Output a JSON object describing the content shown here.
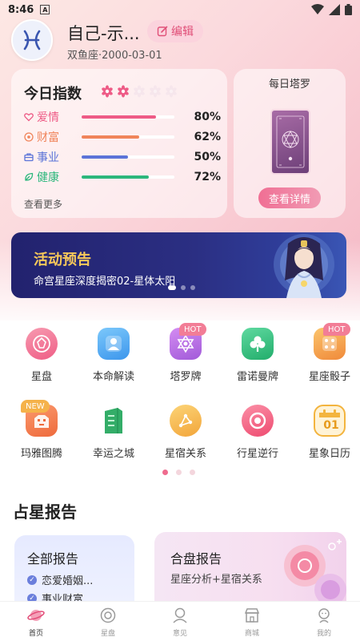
{
  "status_bar": {
    "time": "8:46",
    "notification_glyph": "A"
  },
  "profile": {
    "name": "自己-示...",
    "edit_label": "编辑",
    "sub": "双鱼座·2000-03-01",
    "avatar_icon": "pisces-icon"
  },
  "index": {
    "title": "今日指数",
    "level": 2,
    "level_max": 5,
    "more_label": "查看更多",
    "items": [
      {
        "label": "爱情",
        "value": "80%",
        "fraction": 0.8,
        "color": "#ee5b86",
        "icon": "heart-icon"
      },
      {
        "label": "财富",
        "value": "62%",
        "fraction": 0.62,
        "color": "#f0845a",
        "icon": "coin-icon"
      },
      {
        "label": "事业",
        "value": "50%",
        "fraction": 0.5,
        "color": "#5b74d8",
        "icon": "briefcase-icon"
      },
      {
        "label": "健康",
        "value": "72%",
        "fraction": 0.72,
        "color": "#2cb77c",
        "icon": "leaf-icon"
      }
    ]
  },
  "tarot": {
    "title": "每日塔罗",
    "button": "查看详情"
  },
  "banner": {
    "title": "活动预告",
    "subtitle": "命宫星座深度揭密02-星体太阳",
    "slide_count": 3,
    "active_slide": 0
  },
  "grid": {
    "items": [
      {
        "label": "星盘",
        "icon": "astrolabe-icon",
        "bg": "#f47a9a",
        "badge": ""
      },
      {
        "label": "本命解读",
        "icon": "person-card-icon",
        "bg": "#4aa6f0",
        "badge": ""
      },
      {
        "label": "塔罗牌",
        "icon": "hexagram-icon",
        "bg": "#b66ce0",
        "badge": "HOT"
      },
      {
        "label": "雷诺曼牌",
        "icon": "clover-icon",
        "bg": "#2fc27f",
        "badge": ""
      },
      {
        "label": "星座骰子",
        "icon": "dice-icon",
        "bg": "#f4a548",
        "badge": "HOT"
      },
      {
        "label": "玛雅图腾",
        "icon": "totem-icon",
        "bg": "#f08758",
        "badge": "NEW"
      },
      {
        "label": "幸运之城",
        "icon": "building-icon",
        "bg": "#3ab26c",
        "badge": ""
      },
      {
        "label": "星宿关系",
        "icon": "constellation-icon",
        "bg": "#f5b542",
        "badge": ""
      },
      {
        "label": "行星逆行",
        "icon": "planet-ring-icon",
        "bg": "#f25d7c",
        "badge": ""
      },
      {
        "label": "星象日历",
        "icon": "calendar-icon",
        "bg": "#f6c35a",
        "badge": "",
        "calendar_day": "01"
      }
    ],
    "page_count": 3,
    "active_page": 0
  },
  "reports": {
    "section_title": "占星报告",
    "all": {
      "title": "全部报告",
      "items": [
        "恋爱婚姻...",
        "事业财富..."
      ]
    },
    "synastry": {
      "title": "合盘报告",
      "sub": "星座分析+星宿关系"
    }
  },
  "bottom_nav": [
    {
      "label": "首页",
      "icon": "planet-icon",
      "active": true
    },
    {
      "label": "星盘",
      "icon": "astrolabe-icon",
      "active": false
    },
    {
      "label": "意见",
      "icon": "feedback-icon",
      "active": false
    },
    {
      "label": "商城",
      "icon": "shop-icon",
      "active": false
    },
    {
      "label": "我的",
      "icon": "profile-icon",
      "active": false
    }
  ]
}
